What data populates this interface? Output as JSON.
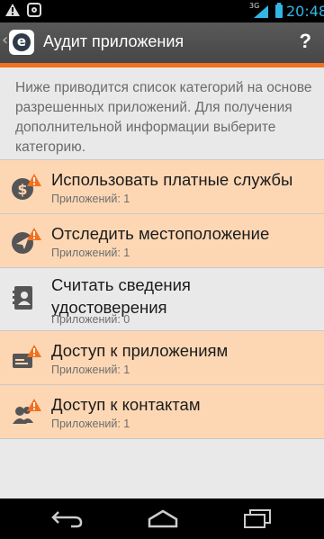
{
  "status_bar": {
    "network": "3G",
    "time": "20:48",
    "icons": [
      "warning-icon",
      "app-notification-icon",
      "signal-icon",
      "battery-icon"
    ]
  },
  "action_bar": {
    "title": "Аудит приложения",
    "help": "?",
    "logo_letter": "e"
  },
  "description": "Ниже приводится список категорий на основе разрешенных приложений. Для получения дополнительной информации выберите категорию.",
  "categories": [
    {
      "title": "Использовать платные службы",
      "count": "Приложений: 1",
      "warning": true,
      "icon": "paid-services-icon"
    },
    {
      "title": "Отследить местоположение",
      "count": "Приложений: 1",
      "warning": true,
      "icon": "location-icon"
    },
    {
      "title": "Считать сведения удостоверения",
      "count": "Приложений: 0",
      "warning": false,
      "icon": "identity-icon"
    },
    {
      "title": "Доступ к приложениям",
      "count": "Приложений: 1",
      "warning": true,
      "icon": "app-access-icon"
    },
    {
      "title": "Доступ к контактам",
      "count": "Приложений: 1",
      "warning": true,
      "icon": "contacts-icon"
    }
  ],
  "colors": {
    "accent": "#f37021",
    "warning_row": "#fdd7b4",
    "background": "#e9e9e9",
    "action_bar": "#505050"
  },
  "nav_bar": [
    "back-icon",
    "home-icon",
    "recent-apps-icon"
  ]
}
